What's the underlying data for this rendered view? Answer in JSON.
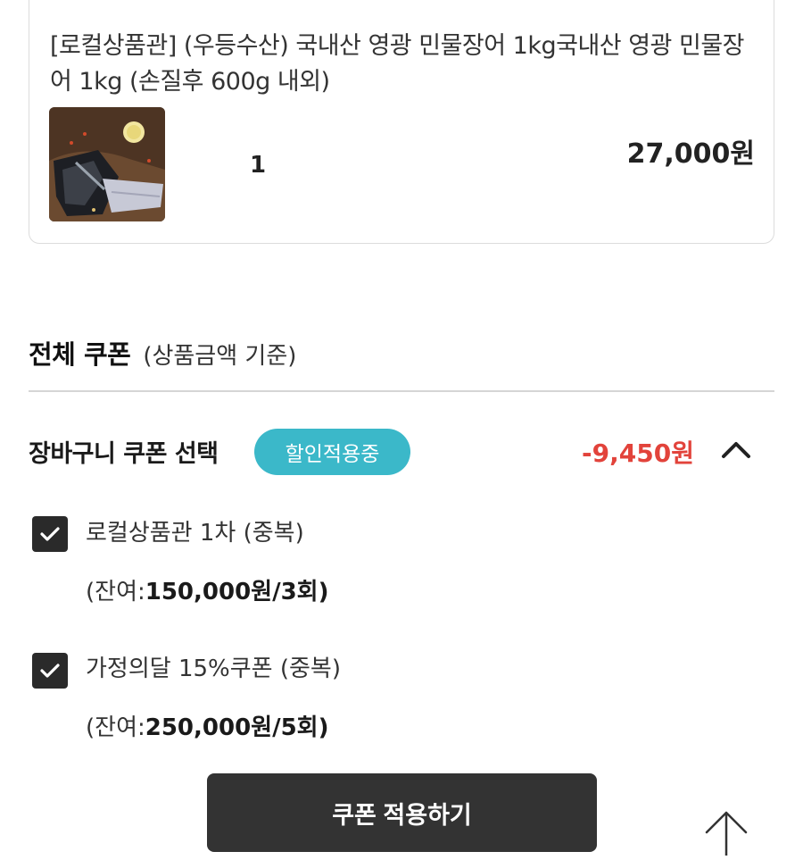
{
  "product": {
    "title": "[로컬상품관] (우등수산) 국내산 영광 민물장어 1kg국내산 영광 민물장어 1kg (손질후 600g 내외)",
    "quantity": "1",
    "price": "27,000원",
    "thumbnail_icon": "eel-fillet-photo"
  },
  "coupons_section": {
    "title": "전체 쿠폰",
    "subtitle": "(상품금액 기준)"
  },
  "cart_coupon": {
    "label": "장바구니 쿠폰 선택",
    "badge": "할인적용중",
    "discount": "-9,450원",
    "toggle_icon": "chevron-up-icon"
  },
  "coupon_list": [
    {
      "name": "로컬상품관 1차 (중복)",
      "remain_prefix": "(잔여:",
      "remain_value": "150,000원/3회)",
      "checked": true
    },
    {
      "name": "가정의달 15%쿠폰 (중복)",
      "remain_prefix": "(잔여:",
      "remain_value": "250,000원/5회)",
      "checked": true
    }
  ],
  "apply_button": {
    "label": "쿠폰 적용하기"
  },
  "scroll_top": {
    "icon": "arrow-up-icon"
  },
  "colors": {
    "badge": "#3bb8c9",
    "discount": "#e2433b",
    "checkbox": "#2a2a2a",
    "button": "#333333"
  }
}
